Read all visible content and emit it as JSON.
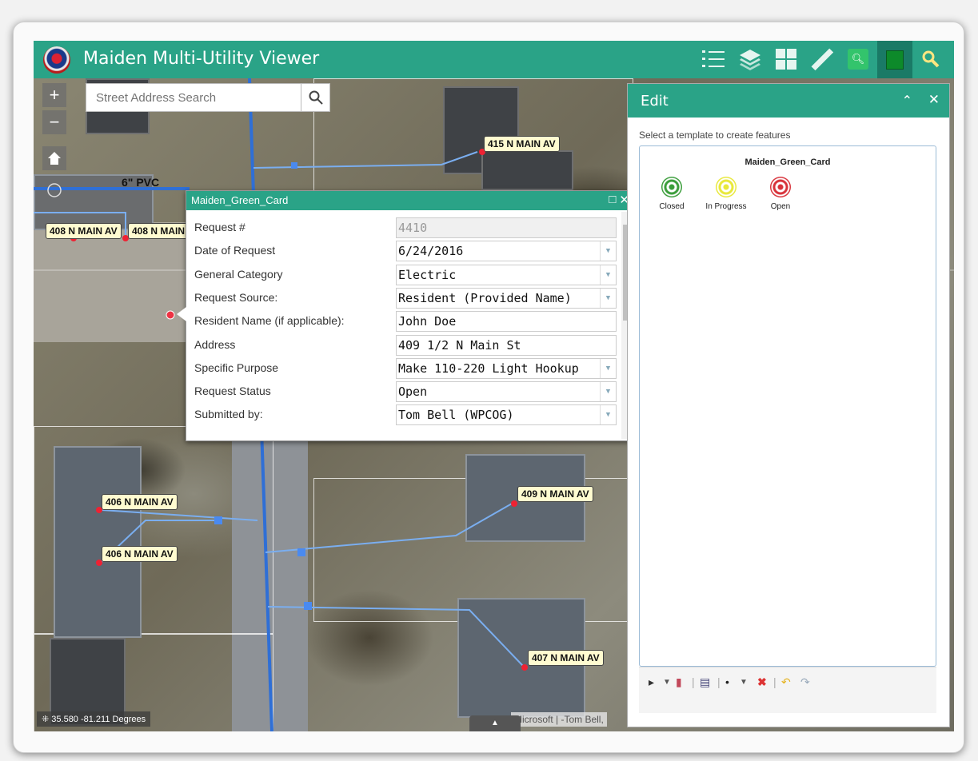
{
  "header": {
    "title": "Maiden Multi-Utility Viewer",
    "icons": [
      "legend-icon",
      "layers-icon",
      "basemap-gallery-icon",
      "measure-icon",
      "search-icon",
      "edit-icon",
      "query-icon"
    ]
  },
  "map": {
    "search_placeholder": "Street Address Search",
    "zoom_in": "+",
    "zoom_out": "−",
    "pipe_label": "6\" PVC",
    "address_labels": [
      "415 N MAIN AV",
      "408 N MAIN AV",
      "408 N MAIN",
      "406 N MAIN AV",
      "406 N MAIN AV",
      "409 N MAIN AV",
      "407 N MAIN AV"
    ],
    "coordinates": "35.580 -81.211 Degrees",
    "attribution": "Microsoft | -Tom Bell,",
    "tab_handle": "▲"
  },
  "popup": {
    "title": "Maiden_Green_Card",
    "fields": [
      {
        "label": "Request #",
        "value": "4410",
        "readonly": true,
        "dropdown": false
      },
      {
        "label": "Date of Request",
        "value": "6/24/2016",
        "readonly": false,
        "dropdown": true
      },
      {
        "label": "General Category",
        "value": "Electric",
        "readonly": false,
        "dropdown": true
      },
      {
        "label": "Request Source:",
        "value": "Resident (Provided Name)",
        "readonly": false,
        "dropdown": true
      },
      {
        "label": "Resident Name (if applicable):",
        "value": "John Doe",
        "readonly": false,
        "dropdown": false
      },
      {
        "label": "Address",
        "value": "409 1/2 N Main St",
        "readonly": false,
        "dropdown": false
      },
      {
        "label": "Specific Purpose",
        "value": "Make 110-220 Light Hookup",
        "readonly": false,
        "dropdown": true
      },
      {
        "label": "Request Status",
        "value": "Open",
        "readonly": false,
        "dropdown": true
      },
      {
        "label": "Submitted by:",
        "value": "Tom Bell (WPCOG)",
        "readonly": false,
        "dropdown": true
      }
    ]
  },
  "edit_panel": {
    "title": "Edit",
    "hint": "Select a template to create features",
    "layer_name": "Maiden_Green_Card",
    "templates": [
      {
        "label": "Closed",
        "color": "#3a9d3a"
      },
      {
        "label": "In Progress",
        "color": "#e8e83a"
      },
      {
        "label": "Open",
        "color": "#d8323a"
      }
    ]
  },
  "colors": {
    "accent": "#2aa387",
    "water_line": "#2f6fd6",
    "service_line": "#7aaef0"
  }
}
